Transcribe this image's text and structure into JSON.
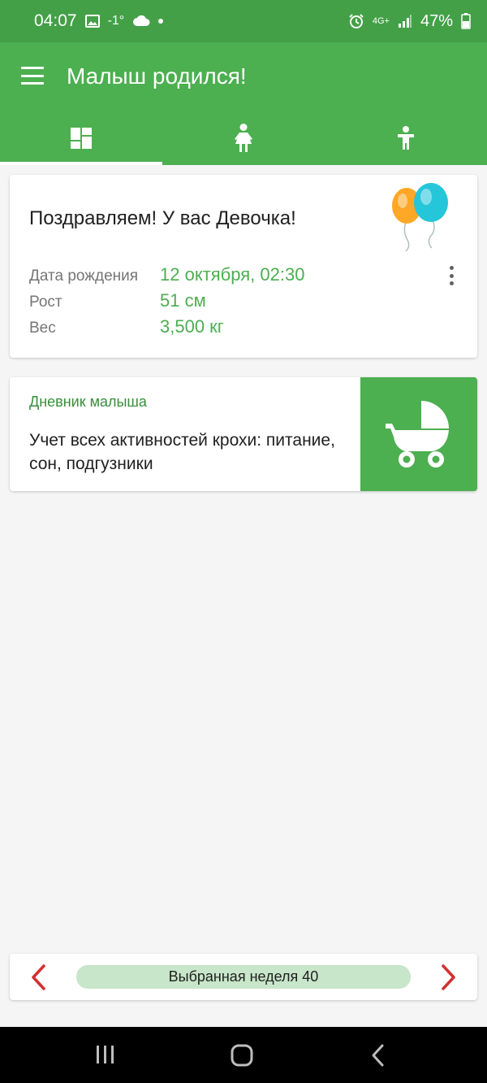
{
  "status_bar": {
    "time": "04:07",
    "temperature": "-1°",
    "network": "4G+",
    "battery": "47%",
    "icons": [
      "image-icon",
      "cloud-icon",
      "alarm-icon",
      "signal-icon",
      "battery-icon"
    ]
  },
  "app_bar": {
    "title": "Малыш родился!",
    "tabs": [
      {
        "icon": "dashboard-icon",
        "active": true
      },
      {
        "icon": "girl-icon",
        "active": false
      },
      {
        "icon": "child-icon",
        "active": false
      }
    ]
  },
  "birth_card": {
    "congrats": "Поздравляем! У вас Девочка!",
    "rows": [
      {
        "label": "Дата рождения",
        "value": "12 октября, 02:30"
      },
      {
        "label": "Рост",
        "value": "51 см"
      },
      {
        "label": "Вес",
        "value": "3,500 кг"
      }
    ]
  },
  "diary_card": {
    "title": "Дневник малыша",
    "description": "Учет всех активностей крохи: питание, сон, подгузники"
  },
  "week_selector": {
    "label": "Выбранная неделя 40"
  },
  "colors": {
    "primary": "#4caf50",
    "status_bar": "#43a047",
    "accent_red": "#d32f2f",
    "pill": "#c8e6c9"
  }
}
